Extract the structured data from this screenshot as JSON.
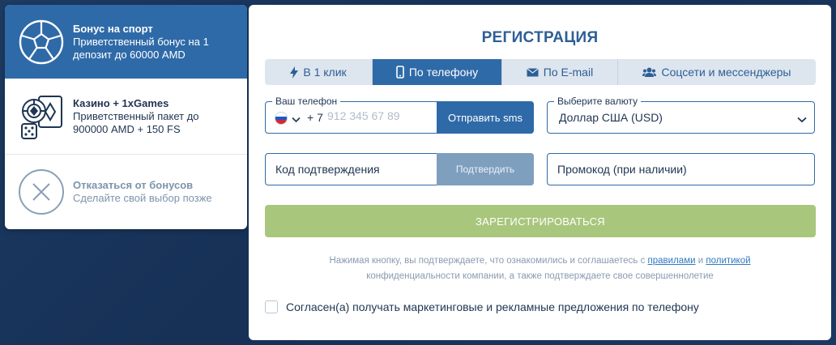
{
  "bonuses": [
    {
      "title": "Бонус на спорт",
      "description": "Приветственный бонус на 1 депозит до 60000 AMD",
      "icon": "soccer-ball-icon"
    },
    {
      "title": "Казино + 1xGames",
      "description": "Приветственный пакет до 900000 AMD + 150 FS",
      "icon": "casino-chips-cards-dice-icon"
    },
    {
      "title": "Отказаться от бонусов",
      "description": "Сделайте свой выбор позже",
      "icon": "close-circle-icon"
    }
  ],
  "registration": {
    "title": "РЕГИСТРАЦИЯ",
    "tabs": [
      {
        "label": "В 1 клик",
        "icon": "lightning-icon"
      },
      {
        "label": "По телефону",
        "icon": "phone-icon"
      },
      {
        "label": "По E-mail",
        "icon": "envelope-icon"
      },
      {
        "label": "Соцсети и мессенджеры",
        "icon": "users-icon"
      }
    ],
    "active_tab": "По телефону",
    "phone": {
      "label": "Ваш телефон",
      "country_code": "+ 7",
      "placeholder": "912 345 67 89",
      "send_sms_label": "Отправить sms"
    },
    "currency": {
      "label": "Выберите валюту",
      "value": "Доллар США (USD)"
    },
    "confirmation": {
      "placeholder": "Код подтверждения",
      "confirm_label": "Подтвердить"
    },
    "promo": {
      "placeholder": "Промокод (при наличии)"
    },
    "register_label": "ЗАРЕГИСТРИРОВАТЬСЯ",
    "terms": {
      "part1": "Нажимая кнопку, вы подтверждаете, что ознакомились и соглашаетесь с ",
      "rules_link": "правилами",
      "and": " и ",
      "policy_link": "политикой",
      "part2": "конфиденциальности компании, а также подтверждаете свое совершеннолетие"
    },
    "consent_label": "Согласен(а) получать маркетинговые и рекламные предложения по телефону"
  },
  "colors": {
    "accent": "#2f6aa8",
    "background": "#1d3a60",
    "register_button": "#a9c67d",
    "confirm_button": "#7f9fbf"
  }
}
